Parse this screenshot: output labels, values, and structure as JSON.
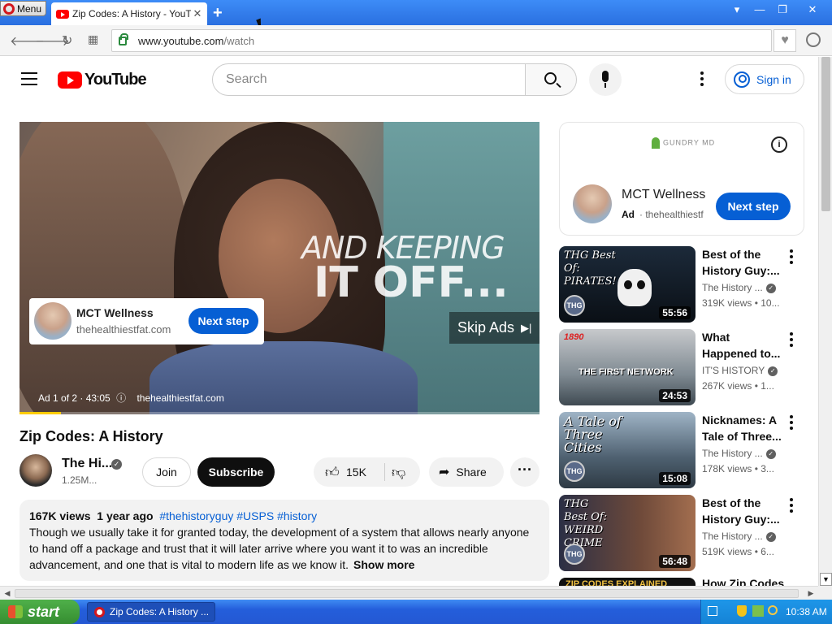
{
  "browser": {
    "menu_label": "Menu",
    "tab_title": "Zip Codes: A History - YouTube",
    "tab_close": "✕",
    "new_tab": "+",
    "window_buttons": [
      "▾",
      "—",
      "❐",
      "✕"
    ],
    "url_domain": "www.youtube.com",
    "url_path": "/watch"
  },
  "youtube": {
    "logo_text": "YouTube",
    "search_placeholder": "Search",
    "sign_in": "Sign in"
  },
  "player": {
    "headline_line1": "AND KEEPING",
    "headline_line2": "IT OFF...",
    "ad_name": "MCT Wellness",
    "ad_domain": "thehealthiestfat.com",
    "ad_cta": "Next step",
    "skip_label": "Skip Ads",
    "skip_icon": "▶|",
    "ad_counter": "Ad 1 of 2 · 43:05",
    "ad_info_icon": "ⓘ",
    "ad_link": "thehealthiestfat.com",
    "ad_progress": 0.08
  },
  "video": {
    "title": "Zip Codes: A History",
    "channel": "The Hi...",
    "verified": "✓",
    "subscribers": "1.25M...",
    "join": "Join",
    "subscribe": "Subscribe",
    "likes": "15K",
    "share": "Share",
    "more": "···"
  },
  "description": {
    "views": "167K views",
    "age": "1 year ago",
    "tags": "#thehistoryguy #USPS #history",
    "lines": [
      "Though we usually take it for granted today, the development of a system that allows nearly anyone",
      "to hand off a package and trust that it will later arrive where you want it to was an incredible",
      "advancement, and one that is vital to modern life as we know it."
    ],
    "show_more": "Show more"
  },
  "side_ad": {
    "brand": "GUNDRY MD",
    "info": "i",
    "name": "MCT Wellness",
    "ad_label": "Ad",
    "domain": "thehealthiestf",
    "cta": "Next step"
  },
  "recommendations": [
    {
      "title_l1": "Best of the",
      "title_l2": "History Guy:...",
      "thumb_text": "THG Best Of: PIRATES!",
      "channel": "The History ...",
      "views": "319K views",
      "age": "• 10...",
      "duration": "55:56"
    },
    {
      "title_l1": "What",
      "title_l2": "Happened to...",
      "thumb_text": "THE FIRST NETWORK",
      "thumb_year": "1890",
      "channel": "IT'S HISTORY",
      "views": "267K views",
      "age": "• 1...",
      "duration": "24:53"
    },
    {
      "title_l1": "Nicknames: A",
      "title_l2": "Tale of Three...",
      "thumb_text": "A Tale of Three Cities",
      "channel": "The History ...",
      "views": "178K views",
      "age": "• 3...",
      "duration": "15:08"
    },
    {
      "title_l1": "Best of the",
      "title_l2": "History Guy:...",
      "thumb_text": "THG Best Of: WEIRD CRIME",
      "channel": "The History ...",
      "views": "519K views",
      "age": "• 6...",
      "duration": "56:48"
    },
    {
      "title_l1": "How Zip Codes",
      "title_l2": "",
      "thumb_text": "ZIP CODES EXPLAINED",
      "channel": "",
      "views": "",
      "age": "",
      "duration": ""
    }
  ],
  "thg_logo": "THG",
  "taskbar": {
    "start": "start",
    "task_title": "Zip Codes: A History ...",
    "clock": "10:38 AM"
  },
  "colors": {
    "accent_blue": "#065fd4",
    "youtube_red": "#ff0000",
    "ad_progress_yellow": "#ffcc00"
  }
}
